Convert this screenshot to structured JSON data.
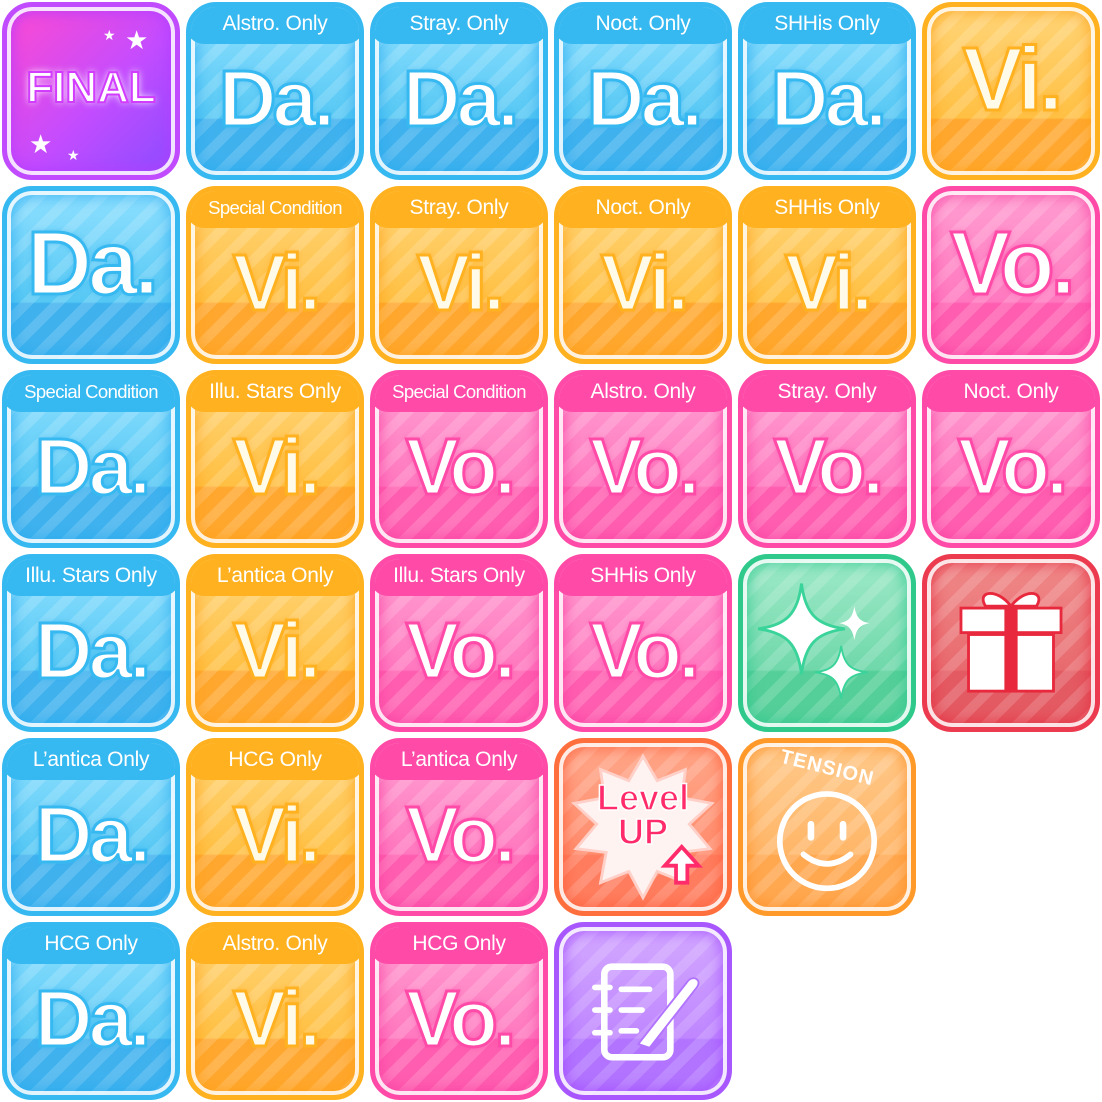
{
  "tiles": [
    {
      "type": "final",
      "label": "FINAL"
    },
    {
      "type": "da",
      "tab": "Alstro. Only",
      "text": "Da."
    },
    {
      "type": "da",
      "tab": "Stray. Only",
      "text": "Da."
    },
    {
      "type": "da",
      "tab": "Noct. Only",
      "text": "Da."
    },
    {
      "type": "da",
      "tab": "SHHis Only",
      "text": "Da."
    },
    {
      "type": "vi",
      "tab": "",
      "text": "Vi."
    },
    {
      "type": "da",
      "tab": "",
      "text": "Da."
    },
    {
      "type": "vi",
      "tab": "Special Condition",
      "text": "Vi."
    },
    {
      "type": "vi",
      "tab": "Stray. Only",
      "text": "Vi."
    },
    {
      "type": "vi",
      "tab": "Noct. Only",
      "text": "Vi."
    },
    {
      "type": "vi",
      "tab": "SHHis Only",
      "text": "Vi."
    },
    {
      "type": "vo",
      "tab": "",
      "text": "Vo."
    },
    {
      "type": "da",
      "tab": "Special Condition",
      "text": "Da."
    },
    {
      "type": "vi",
      "tab": "Illu. Stars Only",
      "text": "Vi."
    },
    {
      "type": "vo",
      "tab": "Special Condition",
      "text": "Vo."
    },
    {
      "type": "vo",
      "tab": "Alstro. Only",
      "text": "Vo."
    },
    {
      "type": "vo",
      "tab": "Stray. Only",
      "text": "Vo."
    },
    {
      "type": "vo",
      "tab": "Noct. Only",
      "text": "Vo."
    },
    {
      "type": "da",
      "tab": "Illu. Stars Only",
      "text": "Da."
    },
    {
      "type": "vi",
      "tab": "L’antica Only",
      "text": "Vi."
    },
    {
      "type": "vo",
      "tab": "Illu. Stars Only",
      "text": "Vo."
    },
    {
      "type": "vo",
      "tab": "SHHis Only",
      "text": "Vo."
    },
    {
      "type": "sparkle"
    },
    {
      "type": "gift"
    },
    {
      "type": "da",
      "tab": "L’antica Only",
      "text": "Da."
    },
    {
      "type": "vi",
      "tab": "HCG Only",
      "text": "Vi."
    },
    {
      "type": "vo",
      "tab": "L’antica Only",
      "text": "Vo."
    },
    {
      "type": "level",
      "line1": "Level",
      "line2": "UP"
    },
    {
      "type": "tension",
      "label": "TENSION"
    },
    {
      "type": "da",
      "tab": "HCG Only",
      "text": "Da."
    },
    {
      "type": "vi",
      "tab": "Alstro. Only",
      "text": "Vi."
    },
    {
      "type": "vo",
      "tab": "HCG Only",
      "text": "Vo."
    },
    {
      "type": "memo"
    }
  ]
}
